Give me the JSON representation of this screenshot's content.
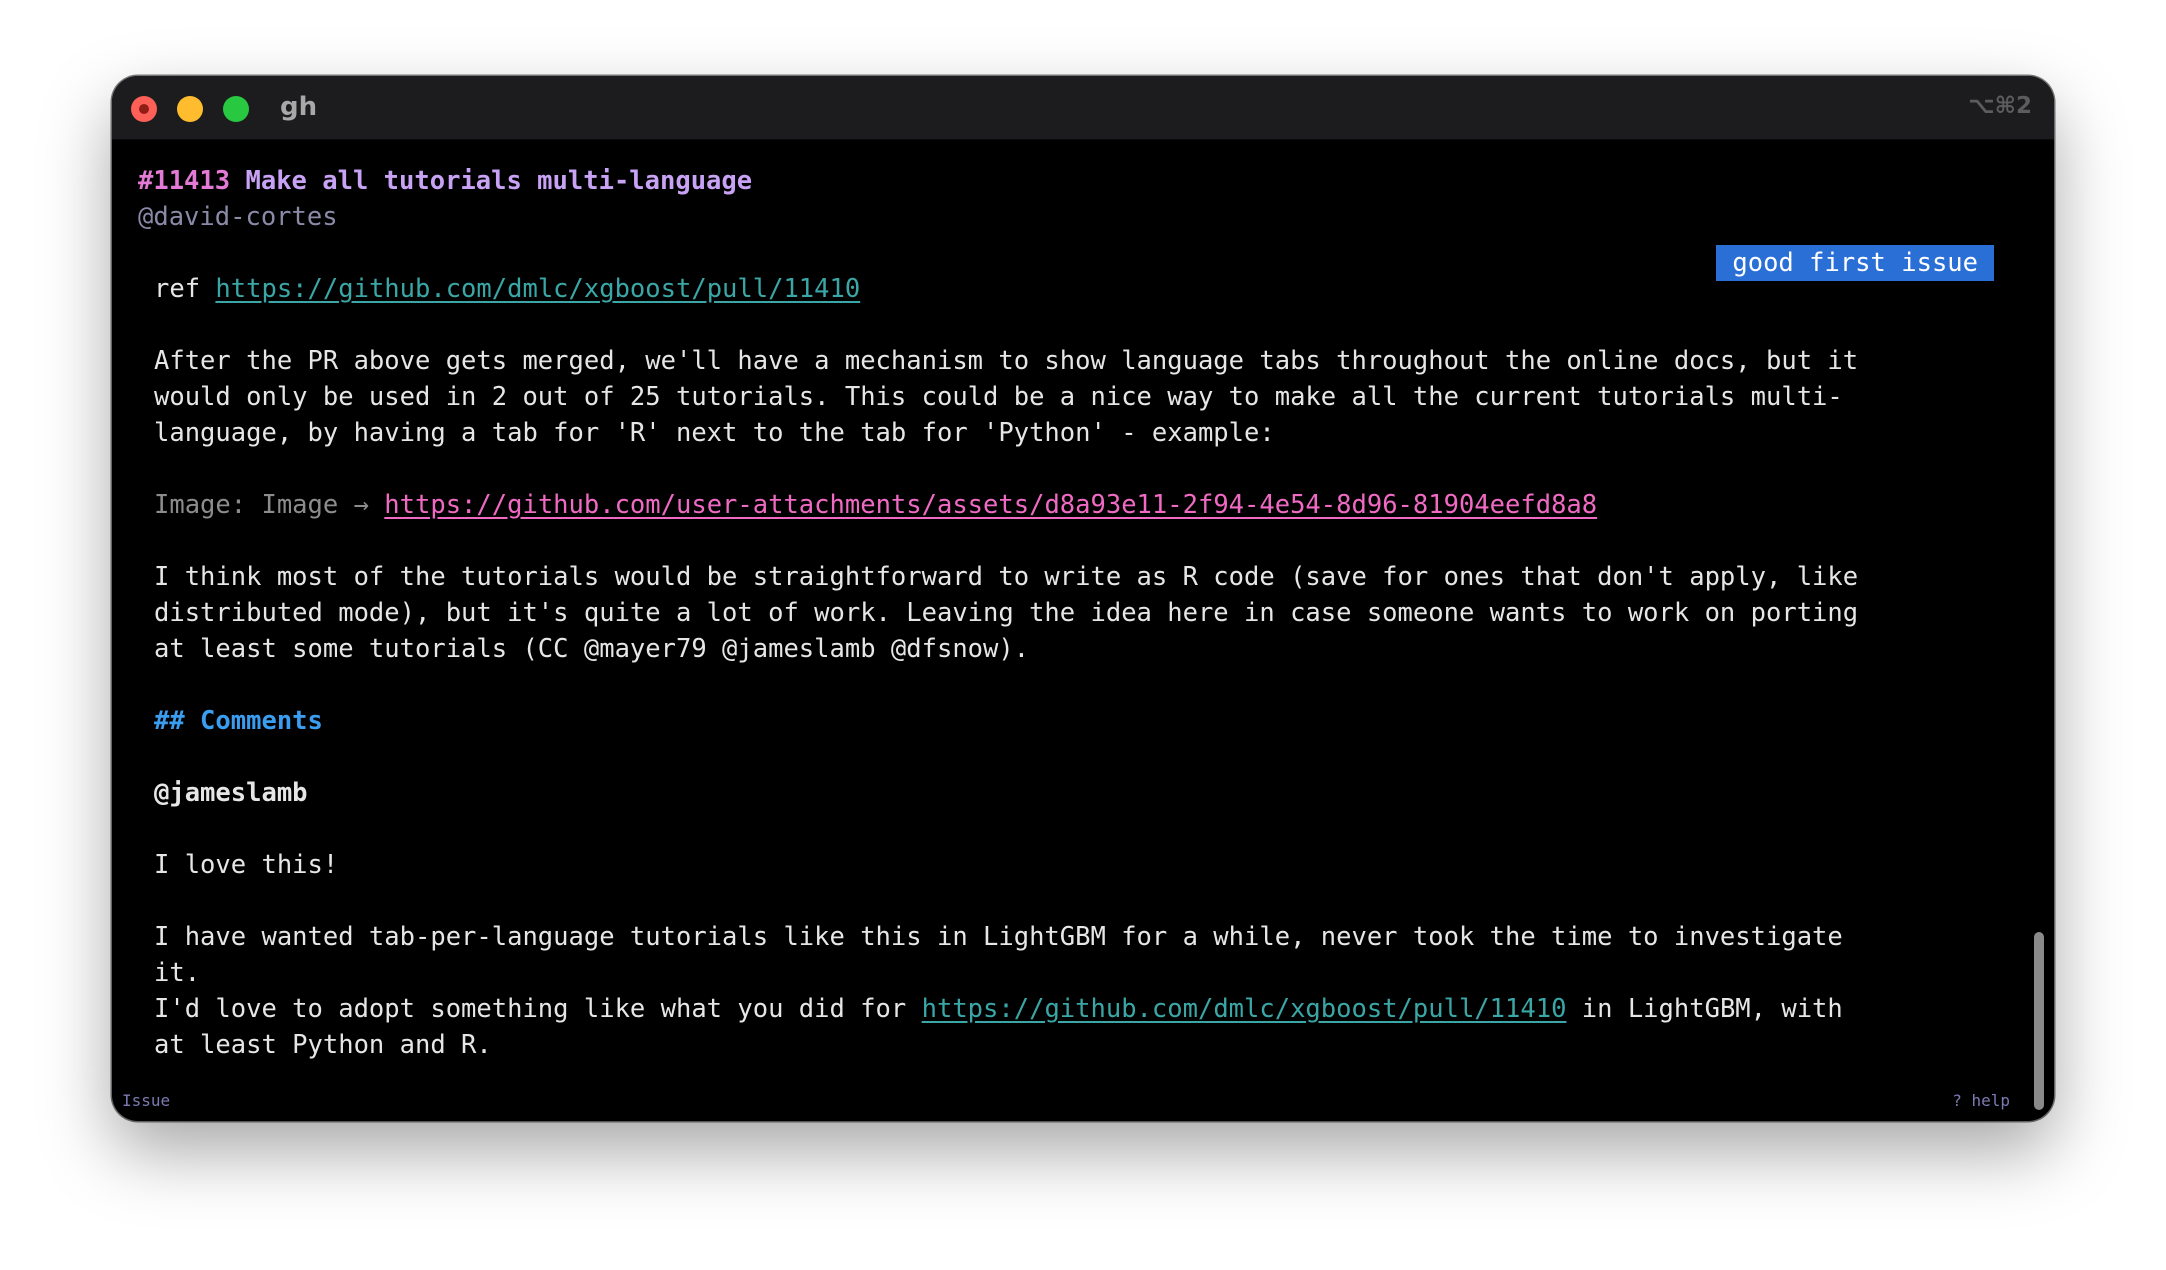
{
  "window": {
    "title": "gh",
    "shortcut": "⌥⌘2"
  },
  "issue": {
    "number": "#11413",
    "title": "Make all tutorials multi-language",
    "author": "@david-cortes",
    "label": "good first issue"
  },
  "body": {
    "ref_prefix": "ref ",
    "ref_link": "https://github.com/dmlc/xgboost/pull/11410",
    "para1": [
      "After the PR above gets merged, we'll have a mechanism to show language tabs throughout the online docs, but it",
      "would only be used in 2 out of 25 tutorials. This could be a nice way to make all the current tutorials multi-",
      "language, by having a tab for 'R' next to the tab for 'Python' - example:"
    ],
    "image_prefix": "Image: Image → ",
    "image_link": "https://github.com/user-attachments/assets/d8a93e11-2f94-4e54-8d96-81904eefd8a8",
    "para2": [
      "I think most of the tutorials would be straightforward to write as R code (save for ones that don't apply, like",
      "distributed mode), but it's quite a lot of work. Leaving the idea here in case someone wants to work on porting",
      "at least some tutorials (CC @mayer79 @jameslamb @dfsnow)."
    ]
  },
  "comments": {
    "heading": "## Comments",
    "items": [
      {
        "author": "@jameslamb",
        "line1": "I love this!",
        "line2": "I have wanted tab-per-language tutorials like this in LightGBM for a while, never took the time to investigate",
        "line3": "it.",
        "line4_prefix": "I'd love to adopt something like what you did for ",
        "line4_link": "https://github.com/dmlc/xgboost/pull/11410",
        "line4_suffix": " in LightGBM, with",
        "line5": "at least Python and R."
      }
    ]
  },
  "statusbar": {
    "left": "Issue",
    "right": "? help"
  },
  "colors": {
    "issue_number": "#e27ad6",
    "issue_title": "#c8a2f5",
    "label_bg": "#2a6fd6",
    "link_teal": "#3aa6a6",
    "link_pink": "#f06ac4",
    "heading": "#3a9df0",
    "status": "#7b7bb3"
  }
}
